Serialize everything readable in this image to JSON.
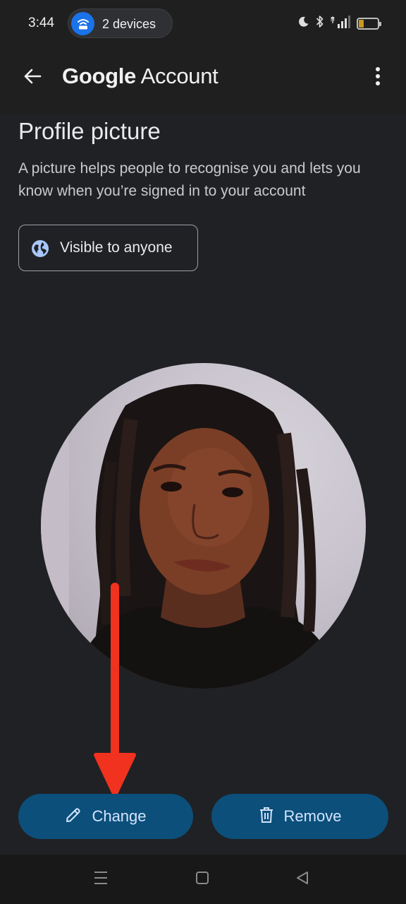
{
  "status_bar": {
    "time": "3:44",
    "hotspot_label": "2 devices",
    "battery_level": "25",
    "battery_fraction": 0.25
  },
  "app_bar": {
    "title_brand": "Google",
    "title_rest": " Account"
  },
  "main": {
    "title": "Profile picture",
    "description": "A picture helps people to recognise you and lets you know when you’re signed in to your account",
    "visibility_label": "Visible to anyone"
  },
  "actions": {
    "change_label": "Change",
    "remove_label": "Remove"
  },
  "icons": {
    "back": "arrow-back-icon",
    "more": "more-vert-icon",
    "globe": "globe-icon",
    "pencil": "pencil-icon",
    "trash": "trash-icon",
    "hotspot": "hotspot-icon"
  },
  "colors": {
    "background": "#1f1f1f",
    "button_bg": "#0b4f7a",
    "button_text": "#d3e3fd",
    "annotation_arrow": "#f0321e",
    "hotspot_blue": "#1a73e8"
  }
}
